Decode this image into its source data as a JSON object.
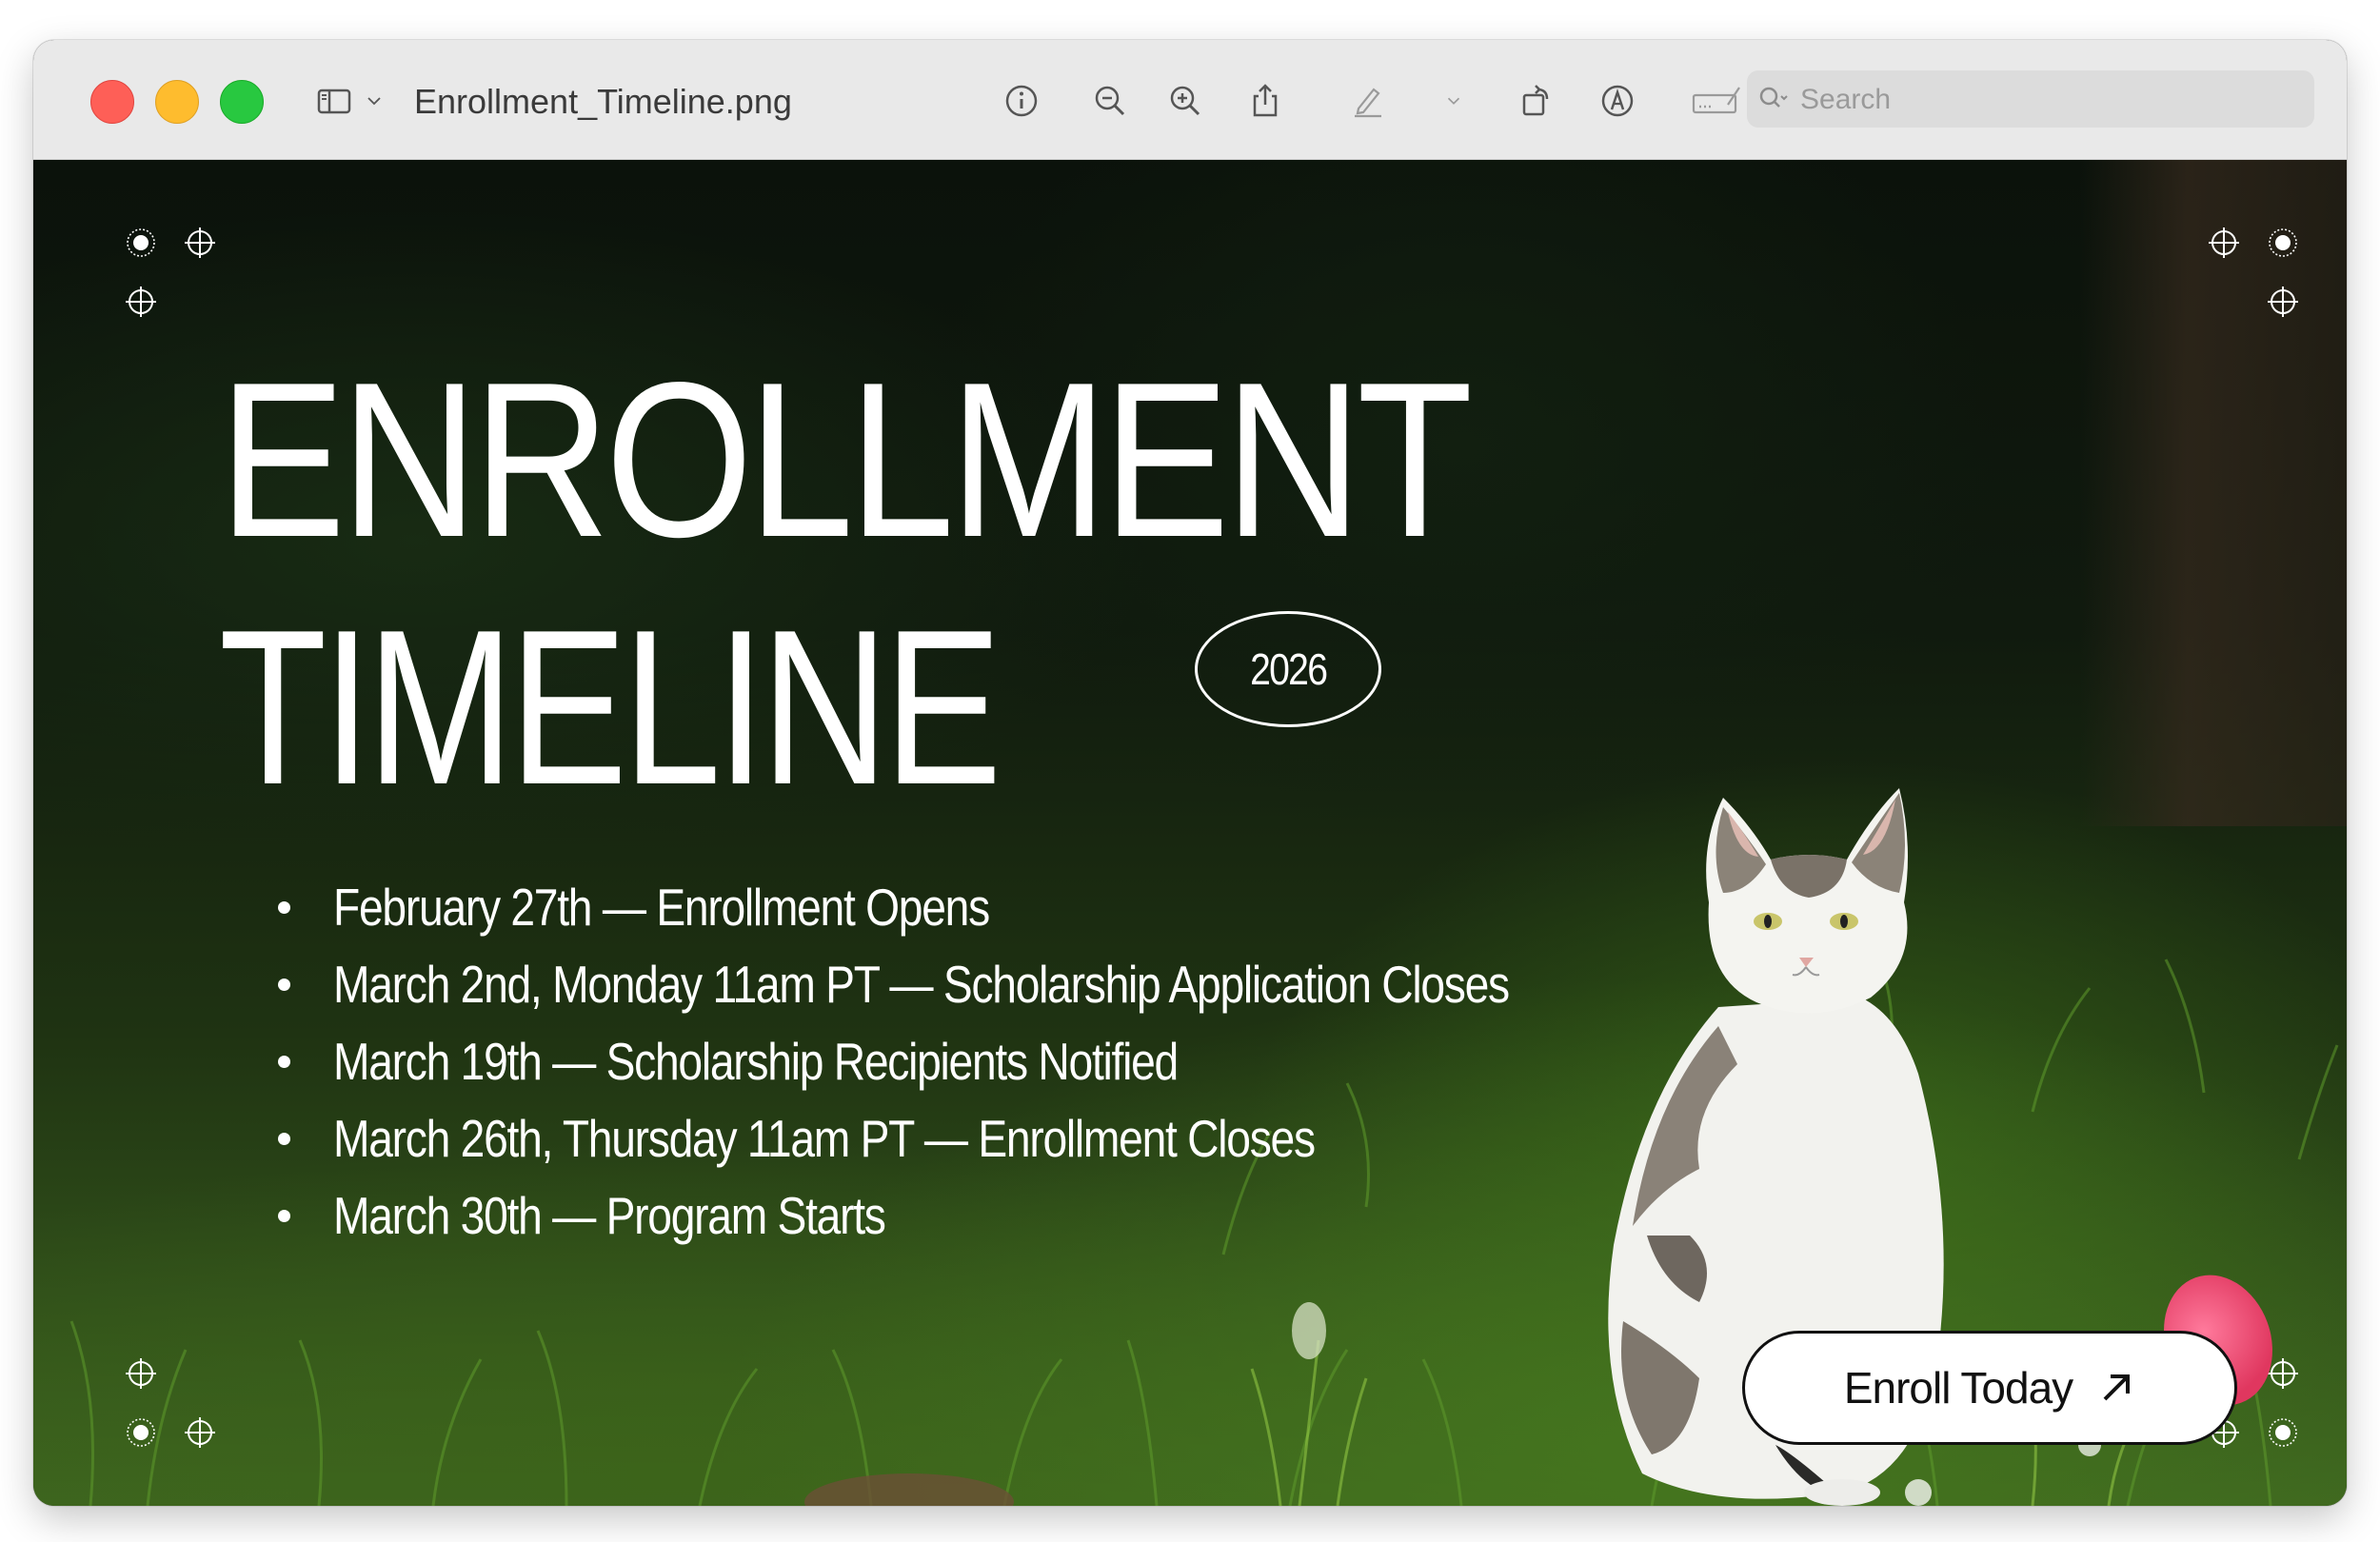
{
  "window": {
    "title": "Enrollment_Timeline.png"
  },
  "toolbar": {
    "search_placeholder": "Search",
    "icons": [
      "sidebar-icon",
      "chevron-down-icon",
      "info-icon",
      "zoom-out-icon",
      "zoom-in-icon",
      "share-icon",
      "markup-pen-icon",
      "chevron-down-icon",
      "rotate-icon",
      "markup-circle-icon",
      "signature-icon",
      "search-icon"
    ]
  },
  "poster": {
    "headline_line1": "ENROLLMENT",
    "headline_line2": "TIMELINE",
    "year": "2026",
    "timeline": [
      "February 27th — Enrollment Opens",
      "March 2nd, Monday 11am PT —  Scholarship Application Closes",
      "March 19th — Scholarship Recipients Notified",
      "March 26th, Thursday 11am PT — Enrollment Closes",
      "March 30th — Program Starts"
    ],
    "cta_label": "Enroll Today"
  },
  "colors": {
    "titlebar_bg": "#e9e9e9",
    "traffic_red": "#fe5f57",
    "traffic_yellow": "#febc2e",
    "traffic_green": "#28c840",
    "text_on_image": "#ffffff",
    "button_bg": "#ffffff",
    "button_text": "#111111"
  }
}
